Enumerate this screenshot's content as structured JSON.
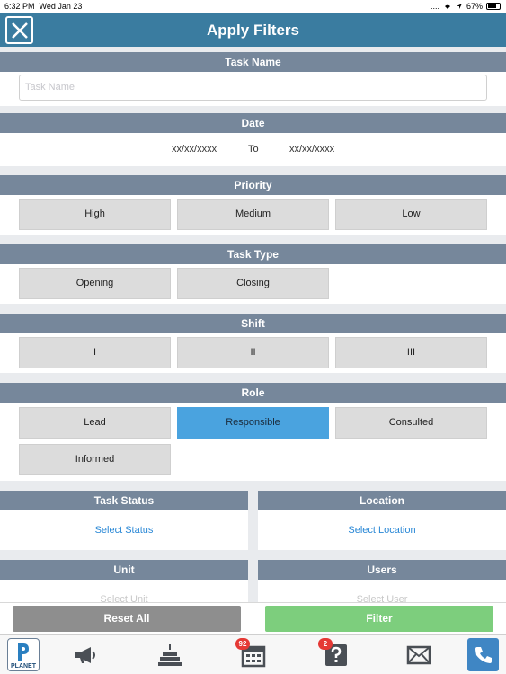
{
  "status_bar": {
    "time": "6:32 PM",
    "date": "Wed Jan 23",
    "signal": "....",
    "battery": "67%"
  },
  "header": {
    "title": "Apply Filters",
    "close_icon": "close-icon"
  },
  "task_name": {
    "label": "Task Name",
    "placeholder": "Task Name"
  },
  "date": {
    "label": "Date",
    "from": "xx/xx/xxxx",
    "to_label": "To",
    "to": "xx/xx/xxxx"
  },
  "priority": {
    "label": "Priority",
    "options": [
      "High",
      "Medium",
      "Low"
    ]
  },
  "task_type": {
    "label": "Task Type",
    "options": [
      "Opening",
      "Closing"
    ]
  },
  "shift": {
    "label": "Shift",
    "options": [
      "I",
      "II",
      "III"
    ]
  },
  "role": {
    "label": "Role",
    "options": [
      "Lead",
      "Responsible",
      "Consulted",
      "Informed"
    ],
    "selected": "Responsible"
  },
  "task_status": {
    "label": "Task Status",
    "value": "Select Status"
  },
  "location": {
    "label": "Location",
    "value": "Select Location"
  },
  "unit": {
    "label": "Unit",
    "value": "Select Unit"
  },
  "users": {
    "label": "Users",
    "value": "Select User"
  },
  "actions": {
    "reset": "Reset All",
    "filter": "Filter"
  },
  "tabbar": {
    "planet": "PLANET",
    "calendar_badge": "92",
    "help_badge": "2",
    "icons": [
      "planet-logo",
      "megaphone-icon",
      "cake-icon",
      "calendar-icon",
      "help-icon",
      "mail-icon",
      "phone-icon"
    ]
  },
  "colors": {
    "header": "#3a7ca0",
    "section": "#76879b",
    "selected": "#4aa3df",
    "reset": "#8e8e8e",
    "filter": "#7dce7d",
    "link": "#2a88d6"
  }
}
